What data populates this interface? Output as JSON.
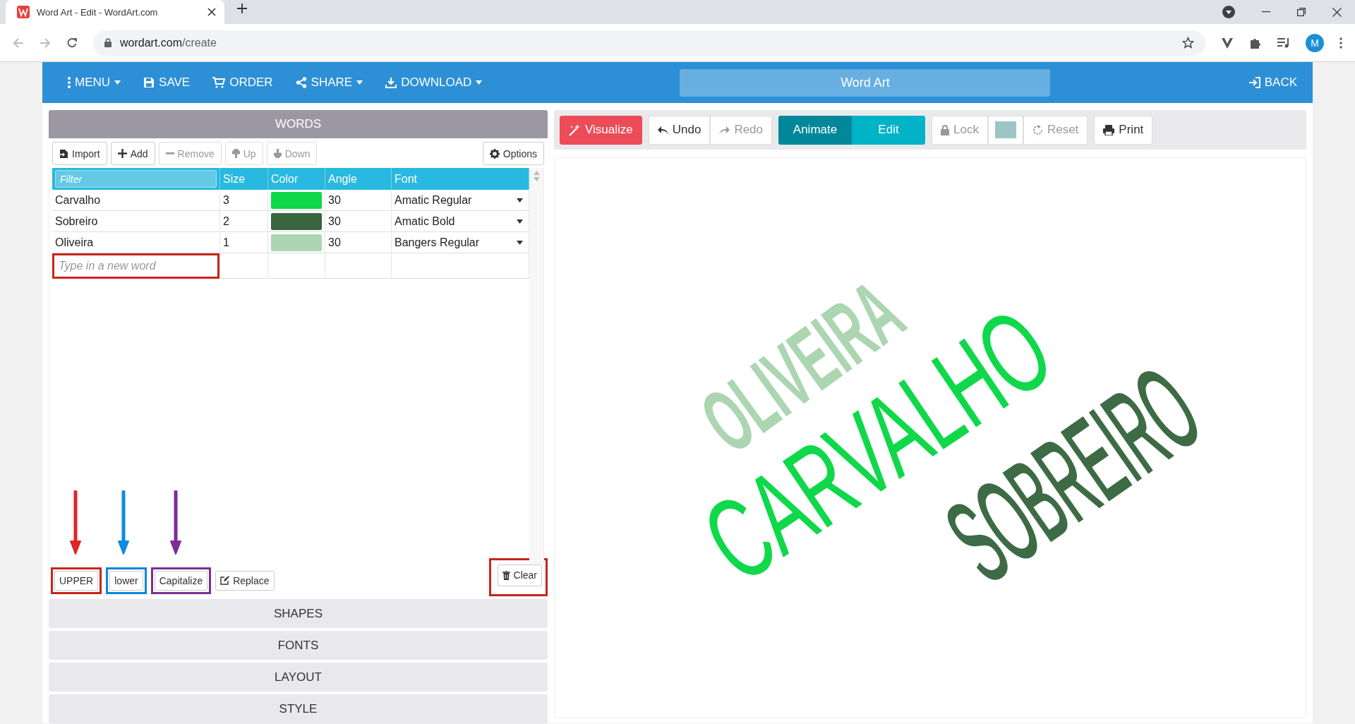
{
  "browser": {
    "tab_title": "Word Art - Edit - WordArt.com",
    "url_host": "wordart.com",
    "url_path": "/create",
    "profile_initial": "M"
  },
  "header": {
    "items": [
      {
        "label": "MENU",
        "dropdown": true
      },
      {
        "label": "SAVE",
        "dropdown": false
      },
      {
        "label": "ORDER",
        "dropdown": false
      },
      {
        "label": "SHARE",
        "dropdown": true
      },
      {
        "label": "DOWNLOAD",
        "dropdown": true
      }
    ],
    "title": "Word Art",
    "back": "BACK"
  },
  "words_panel": {
    "title": "WORDS",
    "buttons": [
      {
        "label": "Import",
        "disabled": false
      },
      {
        "label": "Add",
        "disabled": false
      },
      {
        "label": "Remove",
        "disabled": true
      },
      {
        "label": "Up",
        "disabled": true
      },
      {
        "label": "Down",
        "disabled": true
      }
    ],
    "options": "Options",
    "table": {
      "filter_placeholder": "Filter",
      "columns": [
        "Size",
        "Color",
        "Angle",
        "Font"
      ],
      "rows": [
        {
          "word": "Carvalho",
          "size": "3",
          "color": "#0fd84a",
          "angle": "30",
          "font": "Amatic Regular"
        },
        {
          "word": "Sobreiro",
          "size": "2",
          "color": "#37663f",
          "angle": "30",
          "font": "Amatic Bold"
        },
        {
          "word": "Oliveira",
          "size": "1",
          "color": "#acd5b1",
          "angle": "30",
          "font": "Bangers Regular"
        }
      ],
      "new_word_placeholder": "Type in a new word",
      "new_word_frame": {
        "color": "#c8251b"
      }
    },
    "arrows": [
      {
        "color": "#e0252a"
      },
      {
        "color": "#0d8ce0"
      },
      {
        "color": "#7b2e95"
      }
    ],
    "case_buttons": [
      {
        "label": "UPPER",
        "color": "#c8251b"
      },
      {
        "label": "lower",
        "color": "#0a85dd"
      },
      {
        "label": "Capitalize",
        "color": "#7b2e95"
      }
    ],
    "replace": "Replace",
    "clear": {
      "label": "Clear",
      "color": "#c8251b"
    }
  },
  "sections": [
    "SHAPES",
    "FONTS",
    "LAYOUT",
    "STYLE"
  ],
  "toolbar": {
    "visualize": "Visualize",
    "history": [
      {
        "label": "Undo",
        "disabled": false
      },
      {
        "label": "Redo",
        "disabled": true
      }
    ],
    "modes": [
      {
        "label": "Animate",
        "selected": false
      },
      {
        "label": "Edit",
        "selected": true
      }
    ],
    "lock": {
      "label": "Lock",
      "disabled": true
    },
    "background_swatch": {
      "color": "#9dc5c6"
    },
    "reset": {
      "label": "Reset",
      "disabled": true
    },
    "print": "Print"
  },
  "word_art": [
    {
      "text": "OLIVEIRA",
      "color": "#acd5b1",
      "kind": "bold"
    },
    {
      "text": "CARVALHO",
      "color": "#0fd84a",
      "kind": "thin"
    },
    {
      "text": "SOBREIRO",
      "color": "#3d6b45",
      "kind": "medium"
    }
  ]
}
